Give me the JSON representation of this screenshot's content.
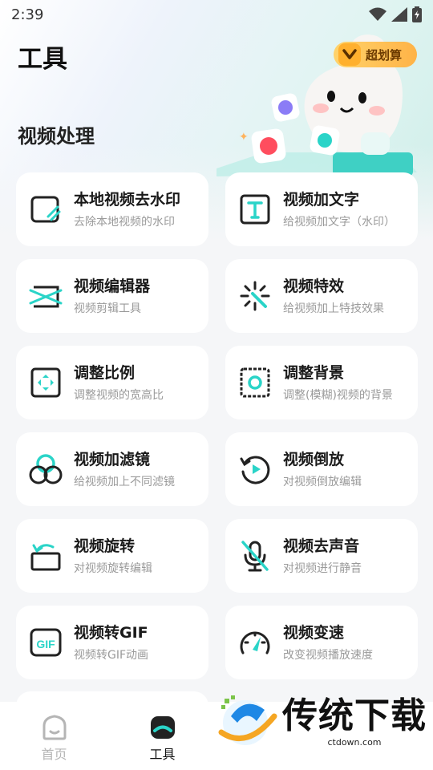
{
  "status_bar": {
    "time": "2:39"
  },
  "header": {
    "title": "工具",
    "deal_badge": "超划算"
  },
  "section": {
    "title": "视频处理"
  },
  "tools": [
    {
      "name": "本地视频去水印",
      "desc": "去除本地视频的水印",
      "icon": "watermark-remove-icon"
    },
    {
      "name": "视频加文字",
      "desc": "给视频加文字（水印）",
      "icon": "text-icon"
    },
    {
      "name": "视频编辑器",
      "desc": "视频剪辑工具",
      "icon": "video-edit-icon"
    },
    {
      "name": "视频特效",
      "desc": "给视频加上特技效果",
      "icon": "magic-wand-icon"
    },
    {
      "name": "调整比例",
      "desc": "调整视频的宽高比",
      "icon": "aspect-ratio-icon"
    },
    {
      "name": "调整背景",
      "desc": "调整(模糊)视频的背景",
      "icon": "background-icon"
    },
    {
      "name": "视频加滤镜",
      "desc": "给视频加上不同滤镜",
      "icon": "filter-icon"
    },
    {
      "name": "视频倒放",
      "desc": "对视频倒放编辑",
      "icon": "reverse-play-icon"
    },
    {
      "name": "视频旋转",
      "desc": "对视频旋转编辑",
      "icon": "rotate-icon"
    },
    {
      "name": "视频去声音",
      "desc": "对视频进行静音",
      "icon": "mic-off-icon"
    },
    {
      "name": "视频转GIF",
      "desc": "视频转GIF动画",
      "icon": "gif-icon"
    },
    {
      "name": "视频变速",
      "desc": "改变视频播放速度",
      "icon": "speedometer-icon"
    }
  ],
  "bottom_nav": {
    "home": "首页",
    "tools": "工具"
  },
  "watermark": {
    "title": "传统下载",
    "url": "ctdown.com"
  },
  "colors": {
    "accent": "#2ad4c8",
    "dark": "#222222"
  }
}
